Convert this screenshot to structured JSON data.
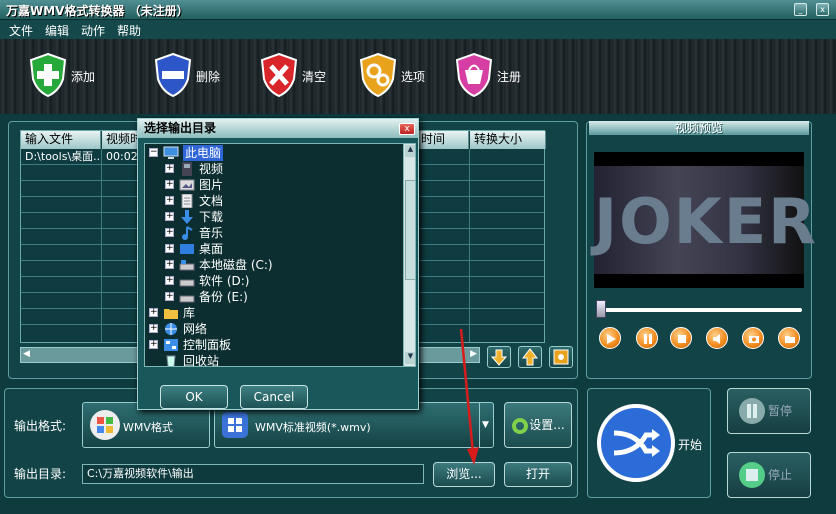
{
  "window": {
    "title": "万嘉WMV格式转换器 （未注册）"
  },
  "menu": [
    "文件",
    "编辑",
    "动作",
    "帮助"
  ],
  "toolbar": {
    "add": "添加",
    "delete": "删除",
    "clear": "清空",
    "options": "选项",
    "register": "注册"
  },
  "table": {
    "columns": [
      "输入文件",
      "视频时",
      "时间",
      "转换大小"
    ],
    "rows": [
      {
        "file": "D:\\tools\\桌面...",
        "duration": "00:02"
      }
    ]
  },
  "preview": {
    "title": "视频预览",
    "video_text": "JOKER"
  },
  "output": {
    "format_label": "输出格式:",
    "format_value": "WMV格式",
    "profile_value": "WMV标准视频(*.wmv)",
    "settings_label": "设置...",
    "dir_label": "输出目录:",
    "dir_value": "C:\\万嘉视频软件\\输出",
    "browse_label": "浏览...",
    "open_label": "打开"
  },
  "actions": {
    "start": "开始",
    "pause": "暂停",
    "stop": "停止"
  },
  "dialog": {
    "title": "选择输出目录",
    "ok": "OK",
    "cancel": "Cancel",
    "tree": {
      "this_pc": "此电脑",
      "children": [
        "视频",
        "图片",
        "文档",
        "下载",
        "音乐",
        "桌面",
        "本地磁盘 (C:)",
        "软件 (D:)",
        "备份 (E:)"
      ],
      "roots": [
        "库",
        "网络",
        "控制面板",
        "回收站"
      ]
    }
  },
  "colors": {
    "background": "#0d3b3e",
    "accent": "#f08a1c",
    "selection": "#2f66d8",
    "arrow": "#d81c1c"
  }
}
